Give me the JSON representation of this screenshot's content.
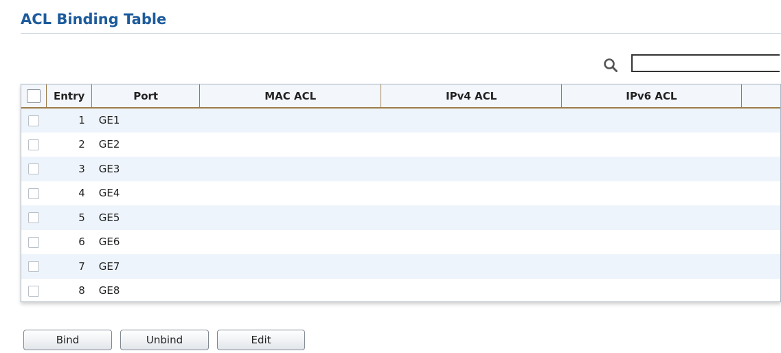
{
  "page": {
    "title": "ACL Binding Table"
  },
  "search": {
    "icon": "search-icon",
    "value": ""
  },
  "table": {
    "columns": [
      "Entry",
      "Port",
      "MAC ACL",
      "IPv4 ACL",
      "IPv6 ACL"
    ],
    "rows": [
      {
        "entry": "1",
        "port": "GE1",
        "mac_acl": "",
        "ipv4_acl": "",
        "ipv6_acl": ""
      },
      {
        "entry": "2",
        "port": "GE2",
        "mac_acl": "",
        "ipv4_acl": "",
        "ipv6_acl": ""
      },
      {
        "entry": "3",
        "port": "GE3",
        "mac_acl": "",
        "ipv4_acl": "",
        "ipv6_acl": ""
      },
      {
        "entry": "4",
        "port": "GE4",
        "mac_acl": "",
        "ipv4_acl": "",
        "ipv6_acl": ""
      },
      {
        "entry": "5",
        "port": "GE5",
        "mac_acl": "",
        "ipv4_acl": "",
        "ipv6_acl": ""
      },
      {
        "entry": "6",
        "port": "GE6",
        "mac_acl": "",
        "ipv4_acl": "",
        "ipv6_acl": ""
      },
      {
        "entry": "7",
        "port": "GE7",
        "mac_acl": "",
        "ipv4_acl": "",
        "ipv6_acl": ""
      },
      {
        "entry": "8",
        "port": "GE8",
        "mac_acl": "",
        "ipv4_acl": "",
        "ipv6_acl": ""
      }
    ]
  },
  "buttons": {
    "bind": "Bind",
    "unbind": "Unbind",
    "edit": "Edit"
  },
  "colors": {
    "title": "#1d5b9c",
    "header_border": "#9c7b4a",
    "row_alt": "#eef4fb"
  }
}
